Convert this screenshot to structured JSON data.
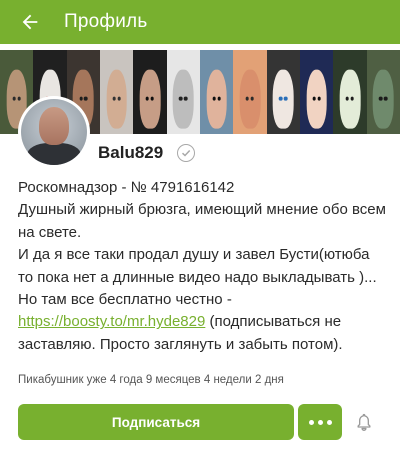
{
  "header": {
    "title": "Профиль",
    "background": "#78b02f"
  },
  "cover": {
    "tiles": [
      {
        "bg": "#4a5a3a",
        "face": "#b69476",
        "eye": "#2b2b2b"
      },
      {
        "bg": "#202020",
        "face": "#e9e6e2",
        "eye": "#b81d1d"
      },
      {
        "bg": "#3c3530",
        "face": "#a5765b",
        "eye": "#1d1d1d"
      },
      {
        "bg": "#c9c4bf",
        "face": "#d2ad93",
        "eye": "#333333"
      },
      {
        "bg": "#1d1d1d",
        "face": "#c69d86",
        "eye": "#0e0e0e"
      },
      {
        "bg": "#e6e6e6",
        "face": "#bdbdbd",
        "eye": "#222222"
      },
      {
        "bg": "#6f8fa8",
        "face": "#e0b39c",
        "eye": "#111111"
      },
      {
        "bg": "#e2a176",
        "face": "#d98f6c",
        "eye": "#2a2a2a"
      },
      {
        "bg": "#343434",
        "face": "#efe7e1",
        "eye": "#2a6fb8"
      },
      {
        "bg": "#1f2a55",
        "face": "#f1d3c2",
        "eye": "#101010"
      },
      {
        "bg": "#2d3b2a",
        "face": "#e3ecd8",
        "eye": "#1d1d1d"
      },
      {
        "bg": "#4f5f43",
        "face": "#6f8a6c",
        "eye": "#1b1b1b"
      }
    ]
  },
  "profile": {
    "username": "Balu829",
    "bio_lines": [
      "Роскомнадзор - № 4791616142",
      "Душный жирный брюзга, имеющий мнение обо всем на свете.",
      "И да я все таки продал душу и завел Бусти(ютюба то пока нет а длинные видео надо выкладывать )... Но там все бесплатно честно -"
    ],
    "link_text": "https://boosty.to/mr.hyde829",
    "bio_tail": " (подписываться не заставляю. Просто заглянуть и забыть потом).",
    "meta": "Пикабушник уже 4 года 9 месяцев 4 недели 2 дня"
  },
  "actions": {
    "subscribe_label": "Подписаться",
    "accent": "#78b02f"
  },
  "icons": {
    "back": "arrow-left-icon",
    "verified": "check-circle-icon",
    "more": "dots-icon",
    "bell": "bell-icon"
  }
}
